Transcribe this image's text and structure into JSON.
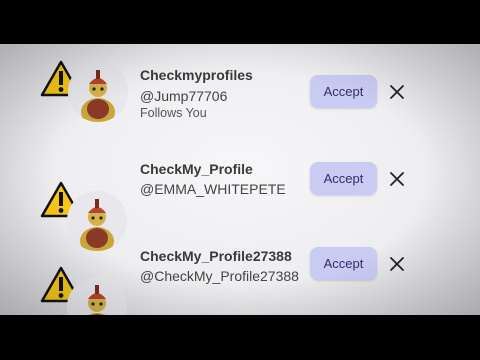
{
  "requests": [
    {
      "name": "Checkmyprofiles",
      "handle": "@Jump77706",
      "status": "Follows You",
      "accept_label": "Accept",
      "warning_icon": "warning-icon",
      "close_icon": "close-icon"
    },
    {
      "name": "CheckMy_Profile",
      "handle": "@EMMA_WHITEPETE",
      "accept_label": "Accept",
      "warning_icon": "warning-icon",
      "close_icon": "close-icon"
    },
    {
      "name": "CheckMy_Profile27388",
      "handle": "@CheckMy_Profile27388",
      "accept_label": "Accept",
      "warning_icon": "warning-icon",
      "close_icon": "close-icon"
    }
  ],
  "colors": {
    "accent": "#c9cbf3",
    "accent_text": "#2f2f6a",
    "warning": "#f5c518",
    "background": "#eeeef1"
  }
}
